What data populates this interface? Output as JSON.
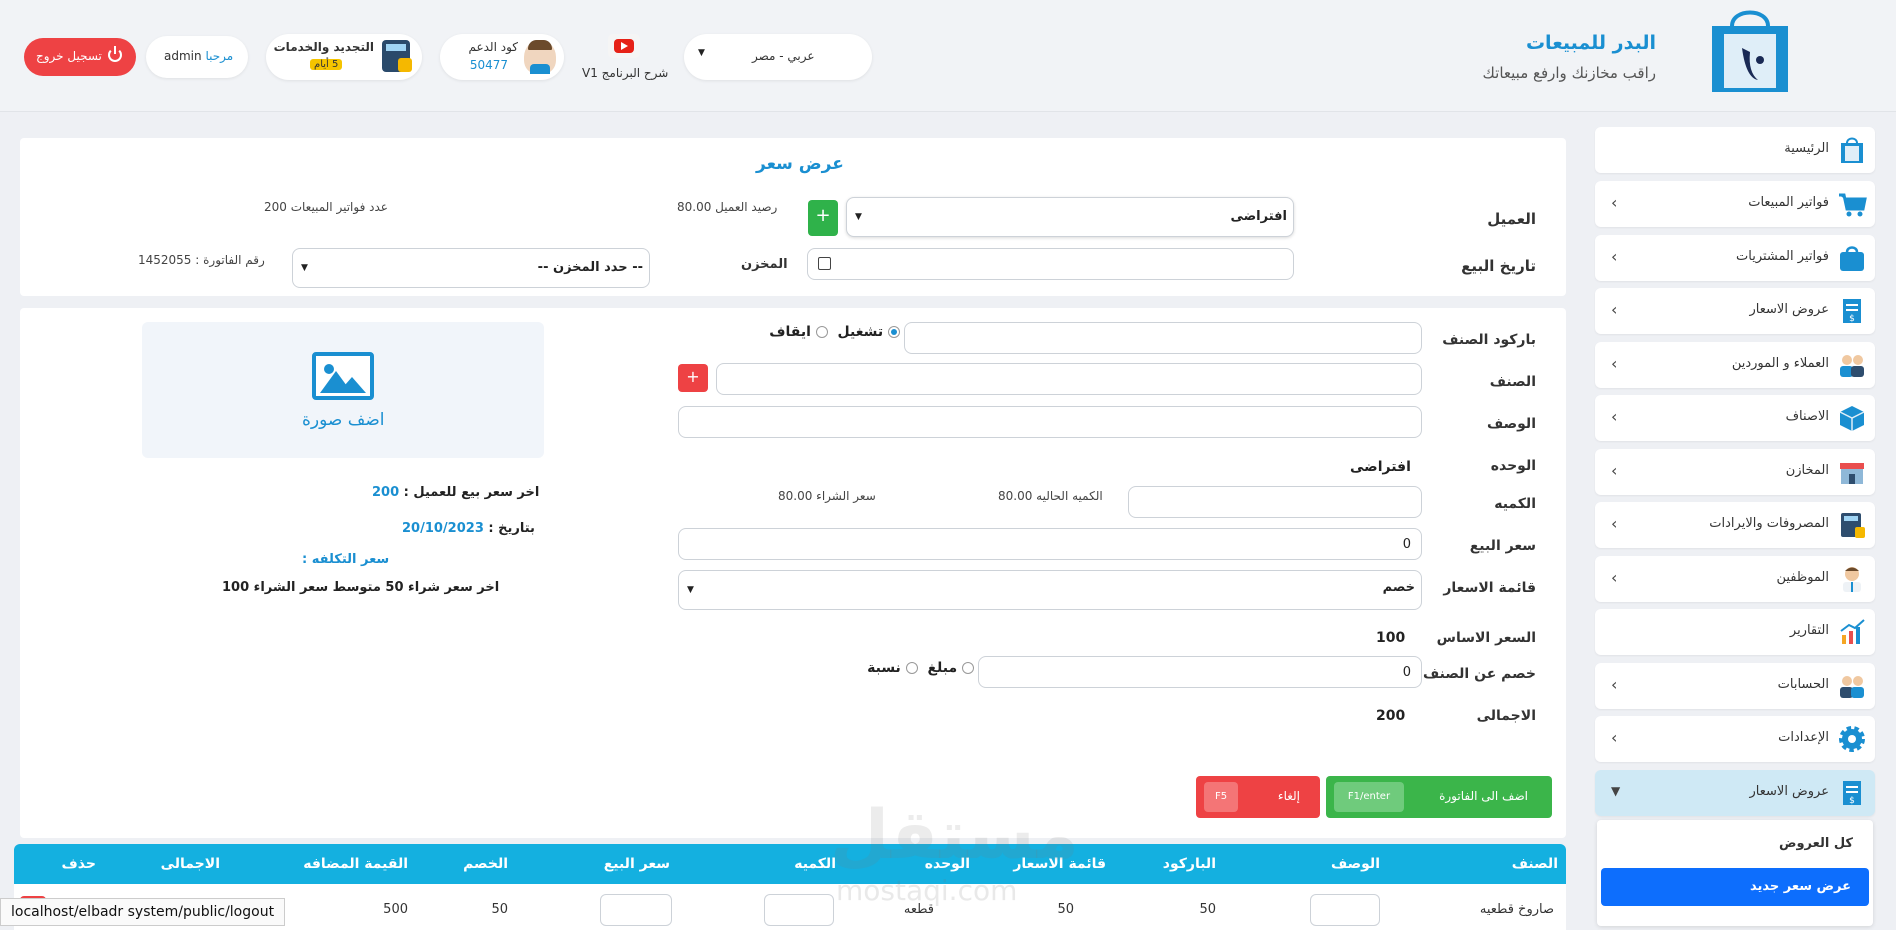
{
  "header": {
    "brand_title": "البدر للمبيعات",
    "brand_subtitle": "راقب مخازنك وارفع مبيعاتك",
    "language_select": "عربي - مصر",
    "video_label": "شرح البرنامج V1",
    "support_label": "كود الدعم",
    "support_code": "50477",
    "renewal_label": "التجديد والخدمات",
    "renewal_badge": "5 أيام",
    "welcome": "مرحبا",
    "username": "admin",
    "logout_label": "تسجيل خروج"
  },
  "sidebar": {
    "items": [
      {
        "label": "الرئيسية",
        "icon": "shopping-bag-icon"
      },
      {
        "label": "فواتير المبيعات",
        "icon": "cart-icon"
      },
      {
        "label": "فواتير المشتريات",
        "icon": "bag-icon"
      },
      {
        "label": "عروض الاسعار",
        "icon": "price-doc-icon"
      },
      {
        "label": "العملاء و الموردين",
        "icon": "users-icon"
      },
      {
        "label": "الاصناف",
        "icon": "box-icon"
      },
      {
        "label": "المخازن",
        "icon": "store-icon"
      },
      {
        "label": "المصروفات والايرادات",
        "icon": "calculator-icon"
      },
      {
        "label": "الموظفين",
        "icon": "employee-icon"
      },
      {
        "label": "التقارير",
        "icon": "report-chart-icon"
      },
      {
        "label": "الحسابات",
        "icon": "accounts-icon"
      },
      {
        "label": "الإعدادات",
        "icon": "gear-icon"
      },
      {
        "label": "عروض الاسعار",
        "icon": "price-doc-icon"
      }
    ],
    "submenu": [
      "كل العروض",
      "عرض سعر جديد"
    ]
  },
  "invoice": {
    "title": "عرض سعر",
    "customer_label": "العميل",
    "customer_value": "افتراضى",
    "customer_balance": "رصيد العميل 80.00",
    "sales_count": "عدد فواتير المبيعات 200",
    "date_label": "تاريخ البيع",
    "store_label": "المخزن",
    "store_placeholder": "-- حدد المخزن --",
    "invoice_number": "رقم الفاتورة : 1452055"
  },
  "item": {
    "barcode_label": "باركود الصنف",
    "on_label": "تشغيل",
    "off_label": "ايقاف",
    "item_label": "الصنف",
    "desc_label": "الوصف",
    "unit_label": "الوحده",
    "unit_value": "افتراضى",
    "qty_label": "الكميه",
    "current_qty": "الكميه الحاليه 80.00",
    "purchase_price": "سعر الشراء 80.00",
    "sale_price_label": "سعر البيع",
    "sale_price_value": "0",
    "price_list_label": "قائمة الاسعار",
    "price_list_value": "خصم",
    "base_price_label": "السعر الاساس",
    "base_price_value": "100",
    "discount_label": "خصم عن الصنف",
    "discount_value": "0",
    "amount_label": "مبلغ",
    "percent_label": "نسبة",
    "total_label": "الاجمالى",
    "total_value": "200",
    "add_image": "اضف صورة",
    "last_sale_label": "اخر سعر بيع للعميل :",
    "last_sale_value": "200",
    "date_prefix": "بتاريخ :",
    "date_value": "20/10/2023",
    "cost_label": "سعر التكلفه :",
    "last_purchase": "اخر سعر شراء 50 متوسط سعر الشراء 100",
    "add_btn": "اضف الى الفاتورة",
    "add_key": "F1/enter",
    "cancel_btn": "إلغاء",
    "cancel_key": "F5"
  },
  "table": {
    "headers": [
      "الصنف",
      "الوصف",
      "الباركود",
      "قائمة الاسعار",
      "الوحده",
      "الكميه",
      "سعر البيع",
      "الخصم",
      "القيمة المضافه",
      "الاجمالى",
      "حذف"
    ],
    "row": {
      "item": "صاروخ قطعيه",
      "barcode": "50",
      "price_list": "50",
      "unit": "قطعه",
      "discount": "50",
      "vat": "500"
    }
  },
  "watermark": {
    "ar": "مستقل",
    "en": "mostaqi.com"
  },
  "status_url": "localhost/elbadr system/public/logout",
  "colors": {
    "accent": "#1a8fd1",
    "green": "#3bb54a",
    "red": "#ee4244",
    "table_header": "#14b0e0"
  }
}
